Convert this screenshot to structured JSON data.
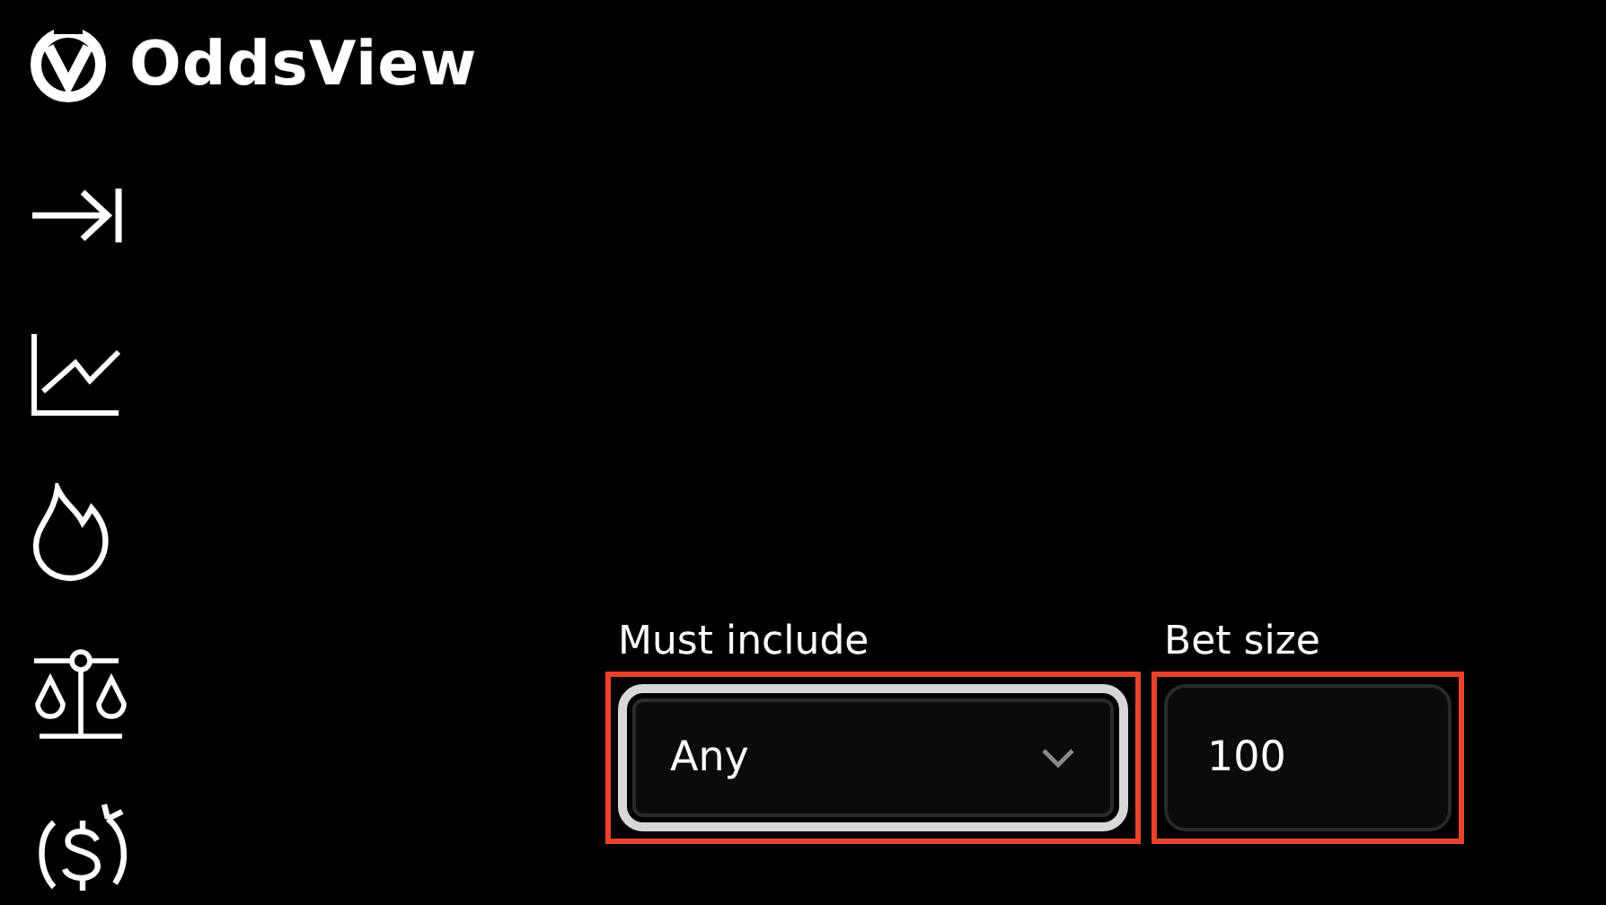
{
  "brand": {
    "name": "OddsView"
  },
  "nav": [
    {
      "kind": "expand"
    },
    {
      "kind": "chart"
    },
    {
      "kind": "flame"
    },
    {
      "kind": "scales"
    },
    {
      "kind": "dollar-cycle"
    }
  ],
  "filters": [
    {
      "kind": "select",
      "label": "Must include",
      "value": "Any",
      "focused": true,
      "highlighted": true
    },
    {
      "kind": "number",
      "label": "Bet size",
      "value": "100",
      "focused": false,
      "highlighted": true
    }
  ]
}
